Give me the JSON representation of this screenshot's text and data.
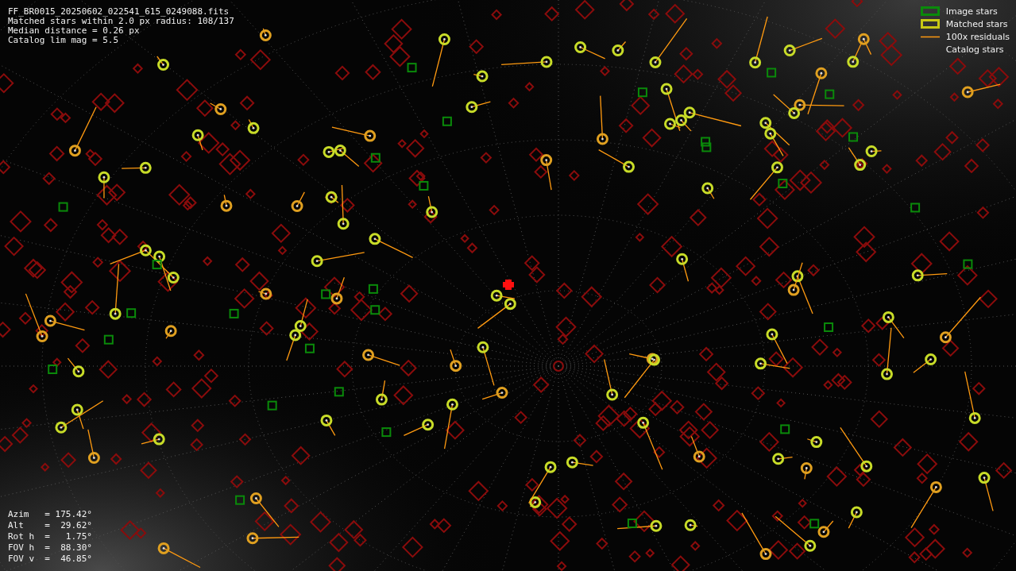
{
  "header_lines": [
    "FF_BR0015_20250602_022541_615_0249088.fits",
    "Matched stars within 2.0 px radius: 108/137",
    "Median distance = 0.26 px",
    "Catalog lim mag = 5.5"
  ],
  "legend": [
    {
      "kind": "image",
      "label": "Image stars"
    },
    {
      "kind": "matched",
      "label": "Matched stars"
    },
    {
      "kind": "residual",
      "label": "100x residuals"
    },
    {
      "kind": "catalog",
      "label": "Catalog stars"
    }
  ],
  "pointing_lines": [
    "Azim   = 175.42°",
    "Alt    =  29.62°",
    "Rot h  =   1.75°",
    "FOV h  =  88.30°",
    "FOV v  =  46.85°"
  ]
}
